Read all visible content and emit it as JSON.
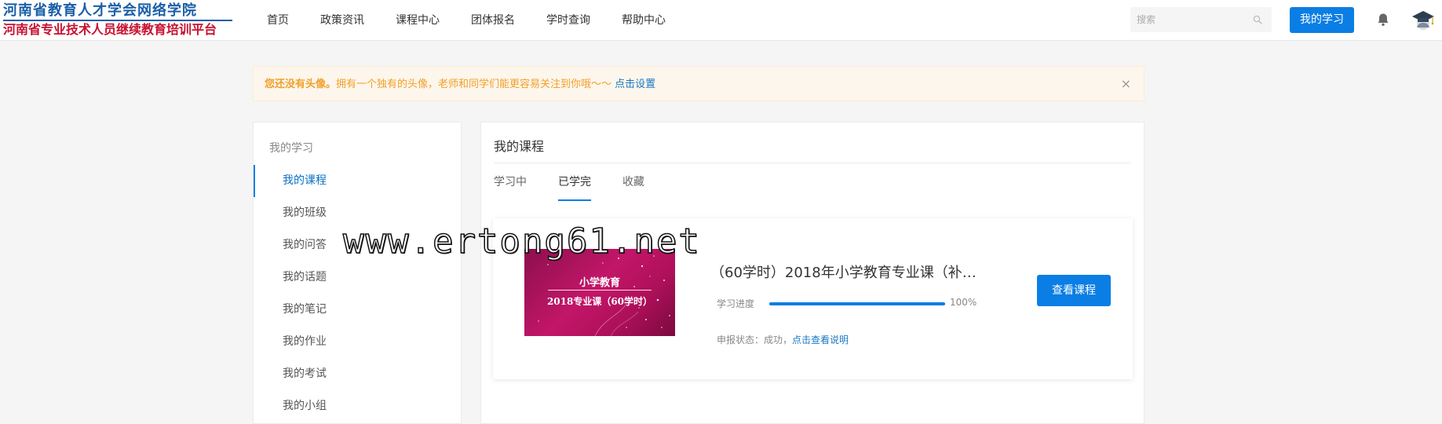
{
  "header": {
    "logo_line1": "河南省教育人才学会网络学院",
    "logo_line2": "河南省专业技术人员继续教育培训平台",
    "nav": [
      {
        "label": "首页"
      },
      {
        "label": "政策资讯"
      },
      {
        "label": "课程中心"
      },
      {
        "label": "团体报名"
      },
      {
        "label": "学时查询"
      },
      {
        "label": "帮助中心"
      }
    ],
    "search": {
      "placeholder": "搜索",
      "icon": "search-icon"
    },
    "my_study_label": "我的学习",
    "bell_icon": "bell-icon",
    "avatar_icon": "graduation-cap-avatar"
  },
  "notice": {
    "strong": "您还没有头像。",
    "text": "拥有一个独有的头像，老师和同学们能更容易关注到你哦～～",
    "link": "点击设置",
    "close": "×"
  },
  "sidebar": {
    "title": "我的学习",
    "items": [
      {
        "label": "我的课程",
        "active": true
      },
      {
        "label": "我的班级"
      },
      {
        "label": "我的问答"
      },
      {
        "label": "我的话题"
      },
      {
        "label": "我的笔记"
      },
      {
        "label": "我的作业"
      },
      {
        "label": "我的考试"
      },
      {
        "label": "我的小组"
      }
    ]
  },
  "main": {
    "title": "我的课程",
    "tabs": [
      {
        "label": "学习中"
      },
      {
        "label": "已学完",
        "active": true
      },
      {
        "label": "收藏"
      }
    ],
    "course": {
      "thumb_title": "小学教育",
      "thumb_sub": "2018专业课（60学时）",
      "name": "（60学时）2018年小学教育专业课（补…",
      "progress_label": "学习进度",
      "progress_value": "100%",
      "progress_fraction": 1.0,
      "status_text": "申报状态：成功，",
      "status_link": "点击查看说明",
      "view_button": "查看课程"
    }
  },
  "watermark": "www.ertong61.net",
  "colors": {
    "accent": "#0a7ee4",
    "notice_bg": "#fdf6ec",
    "notice_text": "#f0a02a",
    "logo_blue": "#1a5fa8",
    "logo_red": "#c8102e"
  }
}
